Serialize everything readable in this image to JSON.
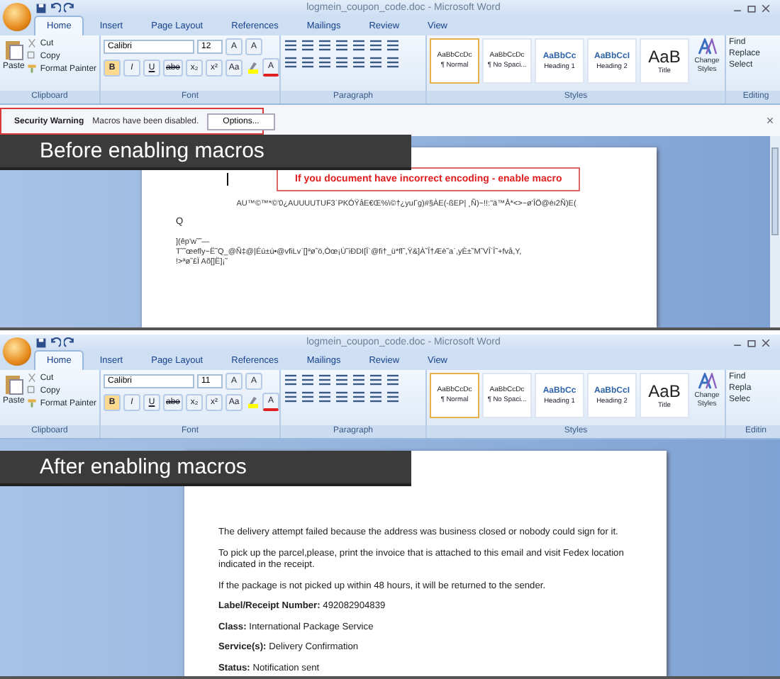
{
  "panels": [
    {
      "banner": "Before enabling macros",
      "title": "logmein_coupon_code.doc - Microsoft Word",
      "tabs": [
        {
          "label": "Home",
          "selected": true
        },
        {
          "label": "Insert",
          "selected": false
        },
        {
          "label": "Page Layout",
          "selected": false
        },
        {
          "label": "References",
          "selected": false
        },
        {
          "label": "Mailings",
          "selected": false
        },
        {
          "label": "Review",
          "selected": false
        },
        {
          "label": "View",
          "selected": false
        }
      ],
      "clipboard": {
        "paste": "Paste",
        "cut": "Cut",
        "copy": "Copy",
        "format_painter": "Format Painter",
        "label": "Clipboard"
      },
      "font": {
        "name": "Calibri",
        "size": "12",
        "grow": [
          "A",
          "A"
        ],
        "buttons": [
          "B",
          "I",
          "U",
          "abe",
          "x₂",
          "x²",
          "Aa"
        ],
        "color_letter": "A",
        "label": "Font"
      },
      "paragraph": {
        "label": "Paragraph"
      },
      "styles": {
        "items": [
          {
            "preview": "AaBbCcDc",
            "name": "¶ Normal",
            "selected": true,
            "kind": "body"
          },
          {
            "preview": "AaBbCcDc",
            "name": "¶ No Spaci...",
            "selected": false,
            "kind": "body"
          },
          {
            "preview": "AaBbCc",
            "name": "Heading 1",
            "selected": false,
            "kind": "heading"
          },
          {
            "preview": "AaBbCcI",
            "name": "Heading 2",
            "selected": false,
            "kind": "heading"
          },
          {
            "preview": "AaB",
            "name": "Title",
            "selected": false,
            "kind": "title"
          }
        ],
        "change": "Change Styles",
        "label": "Styles"
      },
      "editing": {
        "items": [
          "Find",
          "Replace",
          "Select"
        ],
        "label": "Editing"
      },
      "security": {
        "title": "Security Warning",
        "message": "Macros have been disabled.",
        "button": "Options..."
      },
      "document": [
        {
          "kind": "notice",
          "text": "If you document have incorrect encoding - enable macro"
        },
        {
          "kind": "center",
          "text": "AU™©™*©'0¿AUUUUTUF3`PKÓŸåE€Œ%\\©†¿yuΓg)#§ÀE(-ßEP| ¸Ñ)~!!:\"ä™Å*<>~ø'ÎÖ@èı2Ñ)E("
        },
        {
          "kind": "text",
          "text": "Q"
        },
        {
          "kind": "line",
          "text": "](êp'w˜˜—"
        },
        {
          "kind": "line",
          "text": "T˜˜œefly~Ë˜Q_@Ñ‡@|Éú±ú•@vfiLv`[]ªø˜ö,Òœ¡Ù˜iÐDI[Ï`@fi†_ü*fl˜,Ÿ&]À˜Î†Æè˜a`,yÈ±˜M˜VÎ`Î˜+fvå,Y,"
        },
        {
          "kind": "line",
          "text": "!>ªø˜£Ï Aõ[]Ë]¡˜"
        }
      ]
    },
    {
      "banner": "After enabling macros",
      "title": "logmein_coupon_code.doc - Microsoft Word",
      "tabs": [
        {
          "label": "Home",
          "selected": true
        },
        {
          "label": "Insert",
          "selected": false
        },
        {
          "label": "Page Layout",
          "selected": false
        },
        {
          "label": "References",
          "selected": false
        },
        {
          "label": "Mailings",
          "selected": false
        },
        {
          "label": "Review",
          "selected": false
        },
        {
          "label": "View",
          "selected": false
        }
      ],
      "clipboard": {
        "paste": "Paste",
        "cut": "Cut",
        "copy": "Copy",
        "format_painter": "Format Painter",
        "label": "Clipboard"
      },
      "font": {
        "name": "Calibri",
        "size": "11",
        "grow": [
          "A",
          "A"
        ],
        "buttons": [
          "B",
          "I",
          "U",
          "abe",
          "x₂",
          "x²",
          "Aa"
        ],
        "color_letter": "A",
        "label": "Font"
      },
      "paragraph": {
        "label": "Paragraph"
      },
      "styles": {
        "items": [
          {
            "preview": "AaBbCcDc",
            "name": "¶ Normal",
            "selected": true,
            "kind": "body"
          },
          {
            "preview": "AaBbCcDc",
            "name": "¶ No Spaci...",
            "selected": false,
            "kind": "body"
          },
          {
            "preview": "AaBbCc",
            "name": "Heading 1",
            "selected": false,
            "kind": "heading"
          },
          {
            "preview": "AaBbCcI",
            "name": "Heading 2",
            "selected": false,
            "kind": "heading"
          },
          {
            "preview": "AaB",
            "name": "Title",
            "selected": false,
            "kind": "title"
          }
        ],
        "change": "Change Styles",
        "label": "Styles"
      },
      "editing": {
        "items": [
          "Find",
          "Repla",
          "Selec"
        ],
        "label": "Editin"
      },
      "document": [
        {
          "kind": "text",
          "text": "The delivery attempt failed because the address was business closed or nobody could sign for it."
        },
        {
          "kind": "text",
          "text": "To pick up the parcel,please, print the invoice that is attached to this email and visit Fedex location indicated in the receipt."
        },
        {
          "kind": "text",
          "text": "If the package is not picked up within 48 hours, it will be returned to the sender."
        },
        {
          "kind": "field",
          "label": "Label/Receipt Number:",
          "value": "492082904839"
        },
        {
          "kind": "field",
          "label": "Class:",
          "value": "International Package Service"
        },
        {
          "kind": "field",
          "label": "Service(s):",
          "value": "Delivery Confirmation"
        },
        {
          "kind": "field",
          "label": "Status:",
          "value": "Notification sent"
        }
      ]
    }
  ]
}
